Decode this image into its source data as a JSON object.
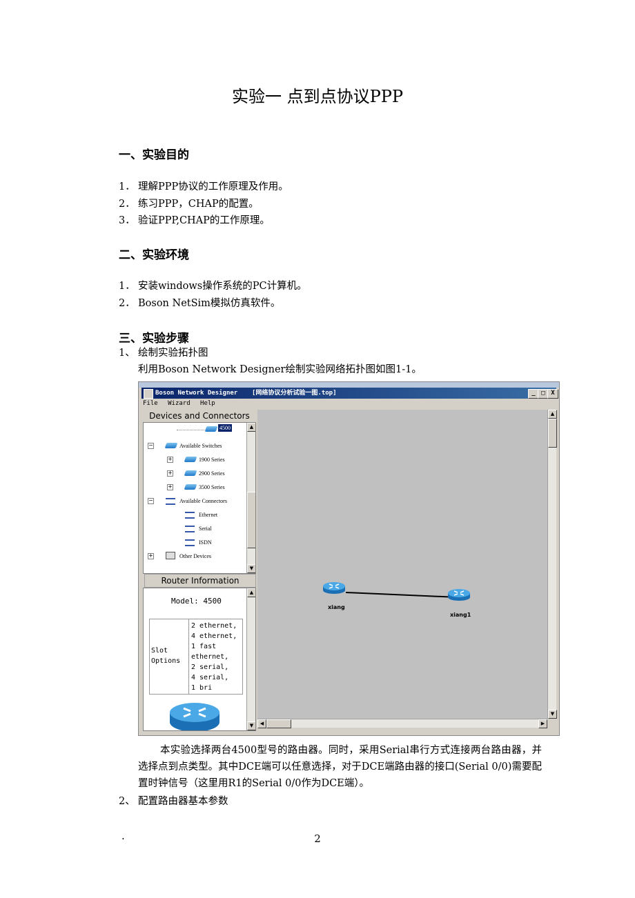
{
  "doc": {
    "title": "实验一  点到点协议PPP",
    "section1": {
      "heading": "一、实验目的",
      "items": [
        {
          "num": "1．",
          "text": "理解PPP协议的工作原理及作用。"
        },
        {
          "num": "2．",
          "text": "练习PPP，CHAP的配置。"
        },
        {
          "num": "3．",
          "text": "验证PPP,CHAP的工作原理。"
        }
      ]
    },
    "section2": {
      "heading": "二、实验环境",
      "items": [
        {
          "num": "1．",
          "text": "安装windows操作系统的PC计算机。"
        },
        {
          "num": "2．",
          "text": "Boson NetSim模拟仿真软件。"
        }
      ]
    },
    "section3": {
      "heading": "三、实验步骤",
      "step1_num": "1、",
      "step1_text": "绘制实验拓扑图",
      "step1_sub": "利用Boson Network Designer绘制实验网络拓扑图如图1-1。",
      "para": "本实验选择两台4500型号的路由器。同时，采用Serial串行方式连接两台路由器，并选择点到点类型。其中DCE端可以任意选择，对于DCE端路由器的接口(Serial 0/0)需要配置时钟信号（这里用R1的Serial 0/0作为DCE端）。",
      "step2_num": "2、",
      "step2_text": "配置路由器基本参数"
    },
    "footer": {
      "bullet": "·",
      "page": "2"
    }
  },
  "app": {
    "title": "Boson Network Designer",
    "file_title": "[网络协议分析试验一图.top]",
    "menu": {
      "file": "File",
      "wizard": "Wizard",
      "help": "Help"
    },
    "window_buttons": {
      "min": "_",
      "max": "□",
      "close": "X"
    },
    "devices_header": "Devices and Connectors",
    "tree": {
      "selected": "4500",
      "switches": "Available Switches",
      "s1900": "1900 Series",
      "s2900": "2900 Series",
      "s3500": "3500 Series",
      "connectors": "Available Connectors",
      "ethernet": "Ethernet",
      "serial": "Serial",
      "isdn": "ISDN",
      "other": "Other Devices"
    },
    "router_info_header": "Router Information",
    "router_info": {
      "model": "Model: 4500",
      "slot_label_1": "Slot",
      "slot_label_2": "Options",
      "slot_values": [
        "2 ethernet,",
        "4 ethernet,",
        "1 fast",
        "ethernet,",
        "2 serial,",
        "4 serial,",
        "1 bri"
      ]
    },
    "canvas": {
      "router1": "xiang",
      "router2": "xiang1"
    }
  }
}
